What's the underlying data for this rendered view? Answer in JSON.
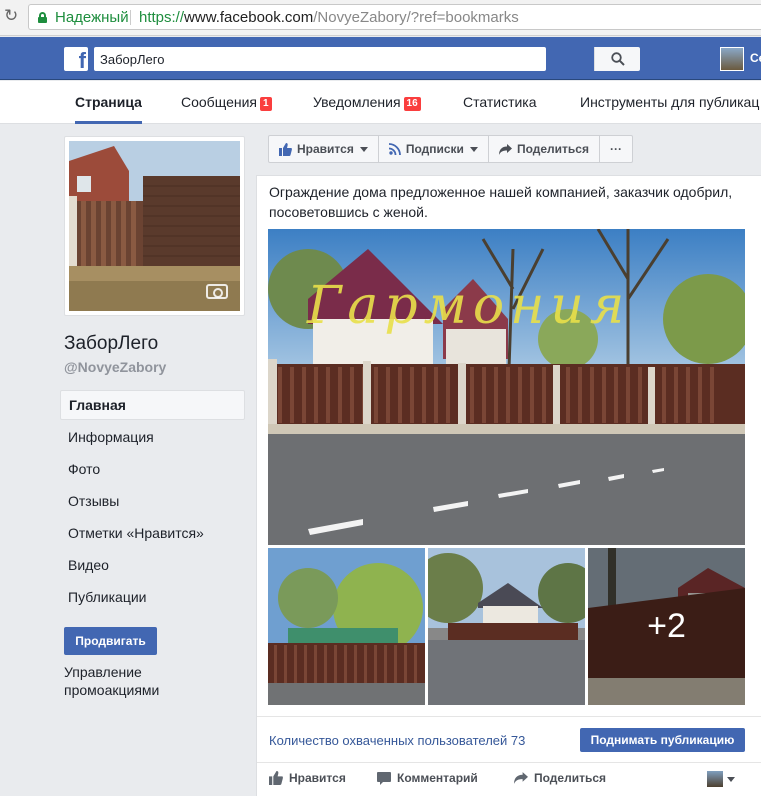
{
  "browser": {
    "secure_label": "Надежный",
    "url_scheme": "https://",
    "url_host": "www.facebook.com",
    "url_path": "/NovyeZabory/?ref=bookmarks"
  },
  "topbar": {
    "search_value": "ЗаборЛего",
    "user_name_fragment": "Се",
    "colors": {
      "bar": "#4267b2"
    }
  },
  "page_tabs": [
    {
      "label": "Страница",
      "active": true
    },
    {
      "label": "Сообщения",
      "badge": "1"
    },
    {
      "label": "Уведомления",
      "badge": "16"
    },
    {
      "label": "Статистика"
    },
    {
      "label": "Инструменты для публикац"
    }
  ],
  "sidebar": {
    "page_name": "ЗаборЛего",
    "page_handle": "@NovyeZabory",
    "nav": [
      {
        "label": "Главная",
        "active": true
      },
      {
        "label": "Информация"
      },
      {
        "label": "Фото"
      },
      {
        "label": "Отзывы"
      },
      {
        "label": "Отметки «Нравится»"
      },
      {
        "label": "Видео"
      },
      {
        "label": "Публикации"
      }
    ],
    "promote_label": "Продвигать",
    "manage_promotions_label": "Управление промоакциями"
  },
  "action_bar": {
    "like_label": "Нравится",
    "follow_label": "Подписки",
    "share_label": "Поделиться",
    "more_label": "···"
  },
  "post": {
    "text": "Ограждение дома предложенное нашей компанией, заказчик одобрил, посоветовшись с женой.",
    "watermark_text": "Гармония",
    "more_photos_label": "+2",
    "reach_label": "Количество охваченных пользователей 73",
    "boost_label": "Поднимать публикацию",
    "reactions": {
      "like_label": "Нравится",
      "comment_label": "Комментарий",
      "share_label": "Поделиться"
    }
  }
}
